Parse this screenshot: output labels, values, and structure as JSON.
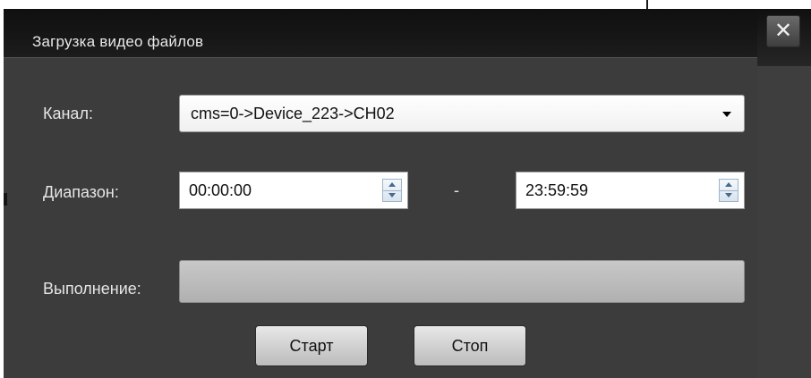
{
  "window": {
    "title": "Загрузка видео файлов",
    "close_glyph": "✕"
  },
  "channel": {
    "label": "Канал:",
    "selected": "cms=0->Device_223->CH02"
  },
  "range": {
    "label": "Диапазон:",
    "start": "00:00:00",
    "separator": "-",
    "end": "23:59:59"
  },
  "progress": {
    "label": "Выполнение:",
    "value_percent": 0
  },
  "buttons": {
    "start": "Старт",
    "stop": "Стоп"
  },
  "icons": {
    "close": "close-icon",
    "dropdown": "chevron-down-icon",
    "spin_up": "spin-up-icon",
    "spin_down": "spin-down-icon"
  },
  "colors": {
    "dialog_bg": "#3c3c3c",
    "titlebar_bg": "#141414",
    "text": "#e6e6e6"
  }
}
